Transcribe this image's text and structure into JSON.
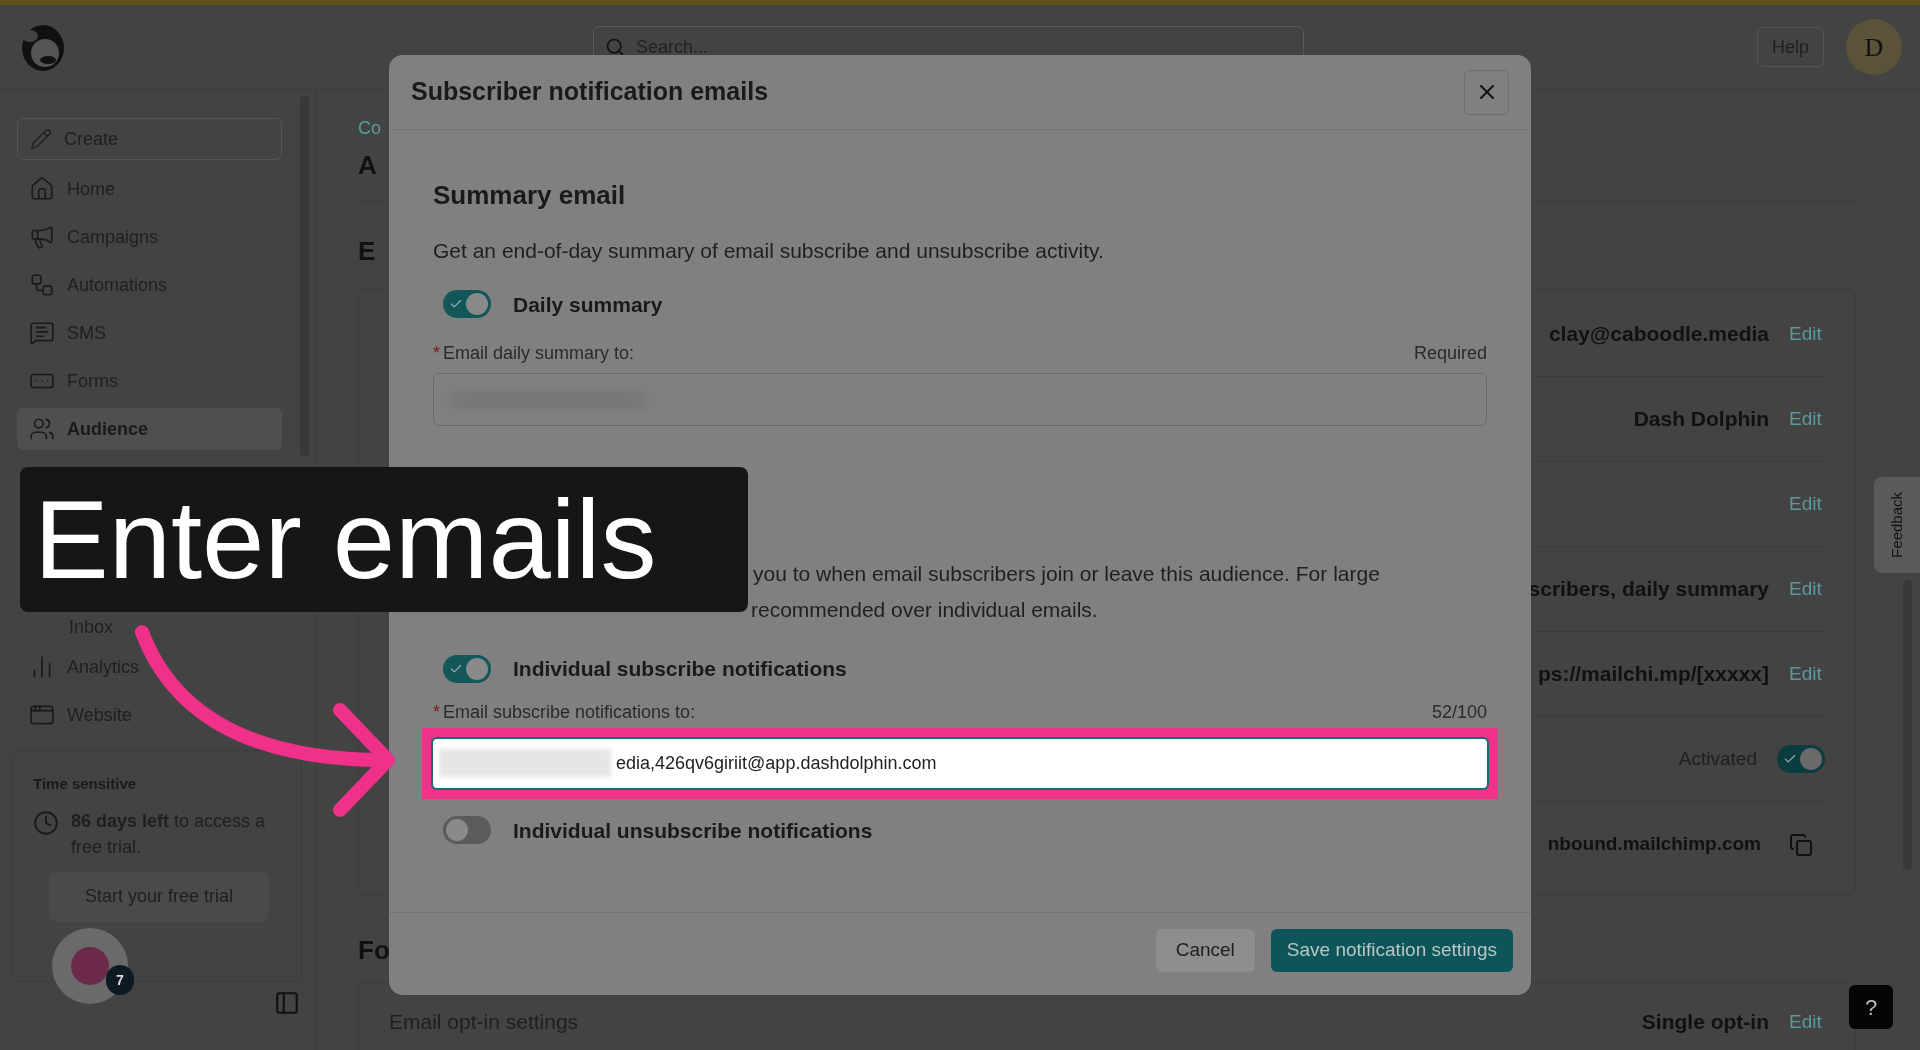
{
  "top_bar": {
    "search_placeholder": "Search...",
    "help": "Help",
    "avatar": "D"
  },
  "sidebar": {
    "create": "Create",
    "items": [
      {
        "label": "Home",
        "selected": false
      },
      {
        "label": "Campaigns",
        "selected": false
      },
      {
        "label": "Automations",
        "selected": false
      },
      {
        "label": "SMS",
        "selected": false
      },
      {
        "label": "Forms",
        "selected": false
      },
      {
        "label": "Audience",
        "selected": true,
        "children": [
          {
            "label": "Inbox",
            "selected": false
          }
        ]
      },
      {
        "label": "Analytics",
        "selected": false
      },
      {
        "label": "Website",
        "selected": false
      }
    ],
    "trial": {
      "title": "Time sensitive",
      "text": "**86 days left** to access a free trial.",
      "button": "Start your free trial"
    },
    "assistant_badge": "7"
  },
  "page": {
    "breadcrumb": "Co",
    "title": "A",
    "section_heading": "E",
    "rows": [
      {
        "kind": "edit",
        "value": "clay@caboodle.media",
        "action": "Edit"
      },
      {
        "kind": "edit",
        "value": "Dash Dolphin",
        "action": "Edit"
      },
      {
        "kind": "edit",
        "action": "Edit"
      },
      {
        "kind": "edit",
        "value": "scribers, daily summary",
        "action": "Edit"
      },
      {
        "kind": "edit",
        "value": "ps://mailchi.mp/[xxxxx]",
        "action": "Edit"
      },
      {
        "kind": "toggle",
        "label": "Activated",
        "on": true
      },
      {
        "kind": "copy",
        "value": "nbound.mailchimp.com"
      }
    ],
    "second_heading": "Fo",
    "optin": {
      "label": "Email opt-in settings",
      "value": "Single opt-in",
      "action": "Edit"
    }
  },
  "feedback": "Feedback",
  "help_button": "?",
  "modal": {
    "title": "Subscriber notification emails",
    "summary": {
      "heading": "Summary email",
      "description": "Get an end-of-day summary of email subscribe and unsubscribe activity.",
      "toggle": {
        "label": "Daily summary",
        "on": true
      },
      "field": {
        "mark": "*",
        "label": "Email daily summary to:",
        "hint": "Required"
      }
    },
    "individual": {
      "description_line1": "you to when email subscribers join or leave this audience. For large",
      "description_line2": "recommended over individual emails.",
      "subscribe_toggle": {
        "label": "Individual subscribe notifications",
        "on": true
      },
      "field": {
        "mark": "*",
        "label": "Email subscribe notifications to:",
        "counter": "52/100",
        "value": "edia,426qv6giriit@app.dashdolphin.com",
        "highlighted": true
      },
      "unsubscribe_toggle": {
        "label": "Individual unsubscribe notifications",
        "on": false
      }
    },
    "cancel": "Cancel",
    "save": "Save notification settings"
  },
  "caption": "Enter emails"
}
